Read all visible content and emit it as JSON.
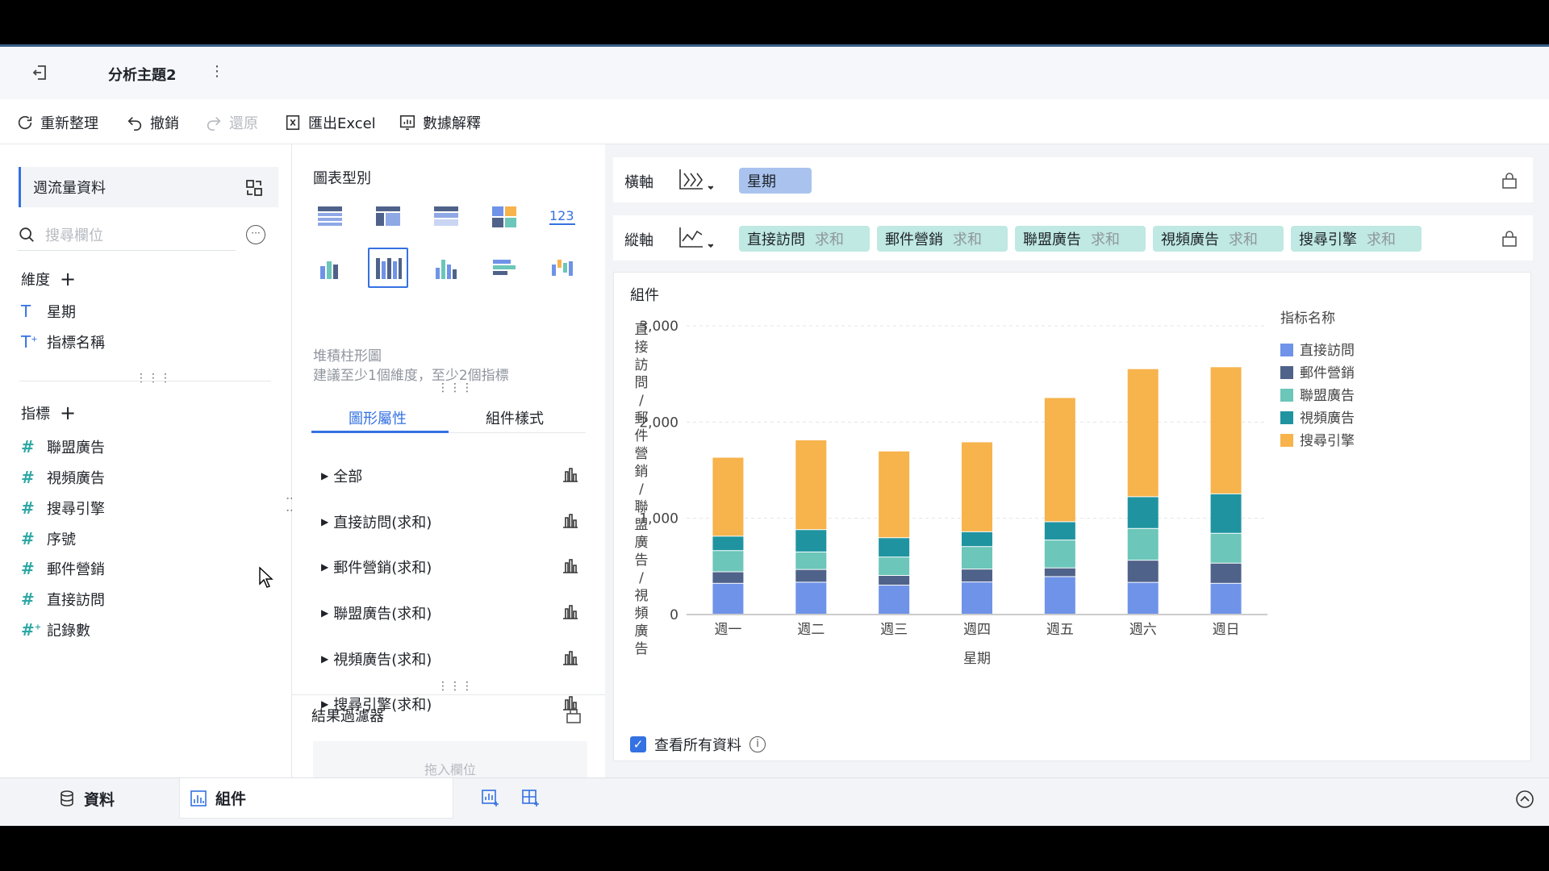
{
  "topbar": {
    "title": "分析主題2",
    "more": "⋮"
  },
  "toolbar": {
    "refresh": "重新整理",
    "undo": "撤銷",
    "redo": "還原",
    "export": "匯出Excel",
    "explain": "數據解釋"
  },
  "left": {
    "dataset": "週流量資料",
    "search_placeholder": "搜尋欄位",
    "dimensions_title": "維度",
    "dimensions": [
      {
        "label": "星期",
        "type": "text"
      },
      {
        "label": "指標名稱",
        "type": "text-calc"
      }
    ],
    "measures_title": "指標",
    "measures": [
      {
        "label": "聯盟廣告"
      },
      {
        "label": "視頻廣告"
      },
      {
        "label": "搜尋引擎"
      },
      {
        "label": "序號"
      },
      {
        "label": "郵件營銷"
      },
      {
        "label": "直接訪問"
      },
      {
        "label": "記錄數"
      }
    ]
  },
  "mid": {
    "chart_type_title": "圖表型別",
    "chart_type_name": "堆積柱形圖",
    "chart_type_hint": "建議至少1個維度，至少2個指標",
    "tab_props": "圖形屬性",
    "tab_style": "組件樣式",
    "props": [
      "全部",
      "直接訪問(求和)",
      "郵件營銷(求和)",
      "聯盟廣告(求和)",
      "視頻廣告(求和)",
      "搜尋引擎(求和)"
    ],
    "filter_title": "結果過濾器",
    "filter_placeholder": "拖入欄位"
  },
  "right": {
    "x_axis_label": "橫軸",
    "y_axis_label": "縱軸",
    "x_field": "星期",
    "y_fields": [
      {
        "name": "直接訪問",
        "agg": "求和"
      },
      {
        "name": "郵件營銷",
        "agg": "求和"
      },
      {
        "name": "聯盟廣告",
        "agg": "求和"
      },
      {
        "name": "視頻廣告",
        "agg": "求和"
      },
      {
        "name": "搜尋引擎",
        "agg": "求和"
      }
    ],
    "card_title": "組件",
    "view_all": "查看所有資料",
    "info": "i"
  },
  "bottom": {
    "data_tab": "資料",
    "widget_tab": "組件"
  },
  "chart_data": {
    "type": "bar",
    "stacked": true,
    "categories": [
      "週一",
      "週二",
      "週三",
      "週四",
      "週五",
      "週六",
      "週日"
    ],
    "xlabel": "星期",
    "ylabel": "直接訪問/郵件營銷/聯盟廣告/視頻廣告",
    "ylim": [
      0,
      3000
    ],
    "yticks": [
      0,
      1000,
      2000,
      3000
    ],
    "ytick_labels": [
      "0",
      "1,000",
      "2,000",
      "3,000"
    ],
    "legend_title": "指标名称",
    "legend_position": "right",
    "series": [
      {
        "name": "直接訪問",
        "color": "#6f93e8",
        "values": [
          320,
          332,
          301,
          334,
          390,
          330,
          320
        ]
      },
      {
        "name": "郵件營銷",
        "color": "#4f6289",
        "values": [
          120,
          132,
          101,
          134,
          90,
          230,
          210
        ]
      },
      {
        "name": "聯盟廣告",
        "color": "#6cc6b9",
        "values": [
          220,
          182,
          191,
          234,
          290,
          330,
          310
        ]
      },
      {
        "name": "視頻廣告",
        "color": "#1f94a0",
        "values": [
          150,
          232,
          201,
          154,
          190,
          330,
          410
        ]
      },
      {
        "name": "搜尋引擎",
        "color": "#f7b34c",
        "values": [
          820,
          932,
          901,
          934,
          1290,
          1330,
          1320
        ]
      }
    ]
  }
}
